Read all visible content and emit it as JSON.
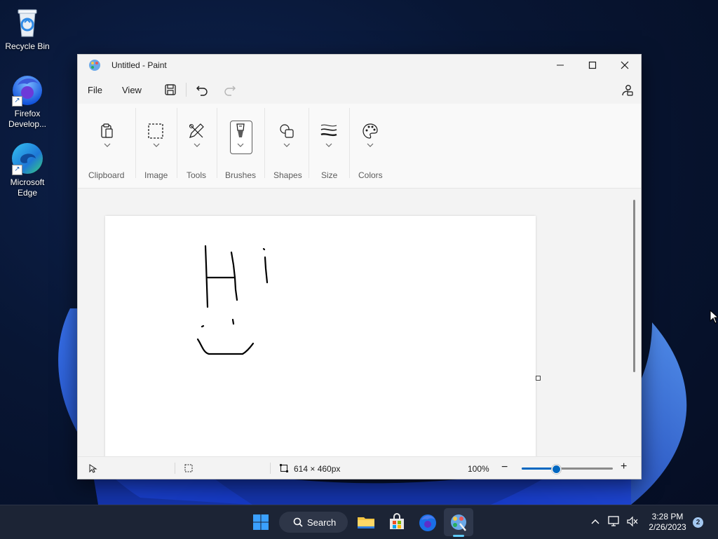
{
  "desktop": {
    "icons": [
      {
        "label": "Recycle Bin"
      },
      {
        "label": "Firefox Develop..."
      },
      {
        "label": "Microsoft Edge"
      }
    ]
  },
  "window": {
    "title": "Untitled - Paint",
    "controls": {
      "minimize": "—",
      "maximize": "☐",
      "close": "✕"
    }
  },
  "menubar": {
    "file": "File",
    "view": "View"
  },
  "ribbon": {
    "groups": [
      {
        "label": "Clipboard",
        "icon": "clipboard-icon"
      },
      {
        "label": "Image",
        "icon": "selection-icon"
      },
      {
        "label": "Tools",
        "icon": "pencil-icon"
      },
      {
        "label": "Brushes",
        "icon": "brush-icon"
      },
      {
        "label": "Shapes",
        "icon": "shapes-icon"
      },
      {
        "label": "Size",
        "icon": "size-icon"
      },
      {
        "label": "Colors",
        "icon": "palette-icon"
      }
    ]
  },
  "statusbar": {
    "canvas_size": "614 × 460px",
    "zoom": "100%",
    "zoom_level": 0.38
  },
  "taskbar": {
    "search_label": "Search",
    "clock_time": "3:28 PM",
    "clock_date": "2/26/2023",
    "notification_count": "2"
  },
  "colors": {
    "accent": "#0067c0",
    "taskbar": "#1c2435"
  }
}
